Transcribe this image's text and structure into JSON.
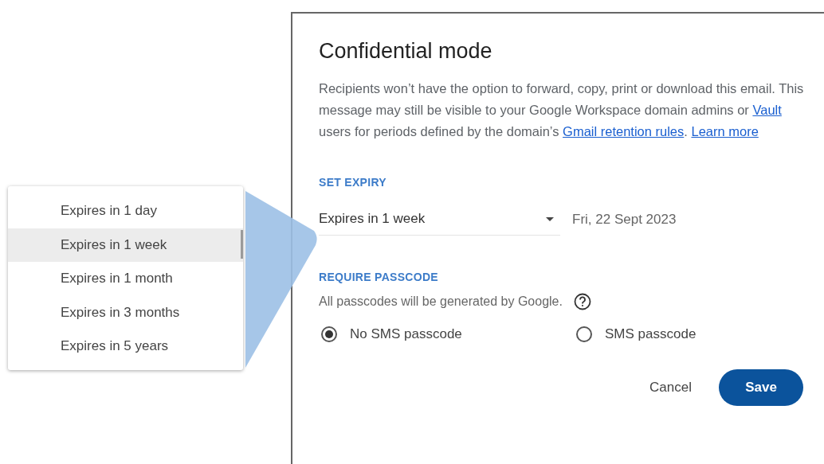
{
  "menu": {
    "items": [
      {
        "label": "Expires in 1 day",
        "selected": false
      },
      {
        "label": "Expires in 1 week",
        "selected": true
      },
      {
        "label": "Expires in 1 month",
        "selected": false
      },
      {
        "label": "Expires in 3 months",
        "selected": false
      },
      {
        "label": "Expires in 5 years",
        "selected": false
      }
    ]
  },
  "dialog": {
    "title": "Confidential mode",
    "description": [
      {
        "kind": "text",
        "text": "Recipients won’t have the option to forward, copy, print or download this email. This message may still be visible to your Google Workspace domain admins or "
      },
      {
        "kind": "link",
        "text": "Vault"
      },
      {
        "kind": "text",
        "text": " users for periods defined by the domain’s "
      },
      {
        "kind": "link",
        "text": "Gmail retention rules"
      },
      {
        "kind": "text",
        "text": ". "
      },
      {
        "kind": "link",
        "text": "Learn more"
      }
    ],
    "expiry": {
      "heading": "SET EXPIRY",
      "value": "Expires in 1 week",
      "date": "Fri, 22 Sept 2023"
    },
    "passcode": {
      "heading": "REQUIRE PASSCODE",
      "note": "All passcodes will be generated by Google.",
      "options": [
        {
          "label": "No SMS passcode",
          "selected": true
        },
        {
          "label": "SMS passcode",
          "selected": false
        }
      ]
    },
    "buttons": [
      {
        "label": "Cancel",
        "kind": "text"
      },
      {
        "label": "Save",
        "kind": "primary"
      }
    ]
  }
}
